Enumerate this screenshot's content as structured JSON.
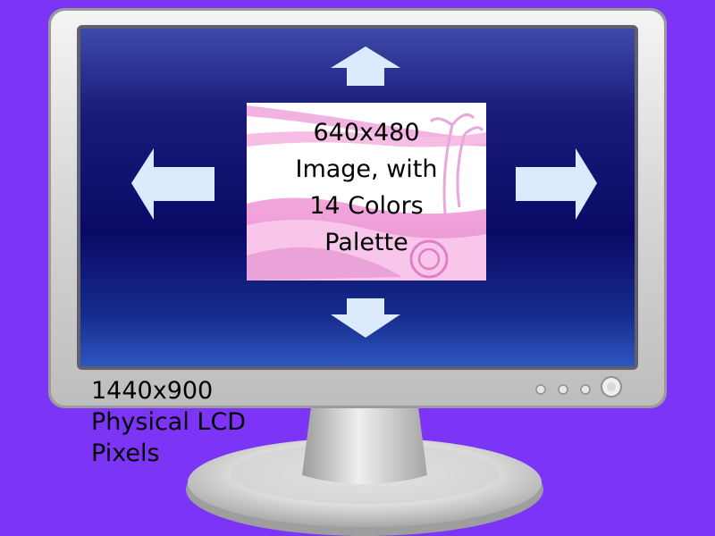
{
  "colors": {
    "background": "#7c35f6",
    "screen_dark": "#0a0a66",
    "screen_light": "#3b4aa8",
    "arrow_fill": "#dbeafc",
    "bezel": "#dcdcdc",
    "image_pink": "#f4a3dd"
  },
  "image_caption": {
    "lines": [
      "640x480",
      "Image, with",
      "14 Colors",
      "Palette"
    ]
  },
  "monitor_caption": {
    "lines": [
      "1440x900",
      "Physical LCD",
      "Pixels"
    ]
  },
  "icons": {
    "arrows": [
      "arrow-up-icon",
      "arrow-down-icon",
      "arrow-left-icon",
      "arrow-right-icon"
    ],
    "buttons": [
      "monitor-button-icon",
      "monitor-power-button-icon"
    ]
  }
}
